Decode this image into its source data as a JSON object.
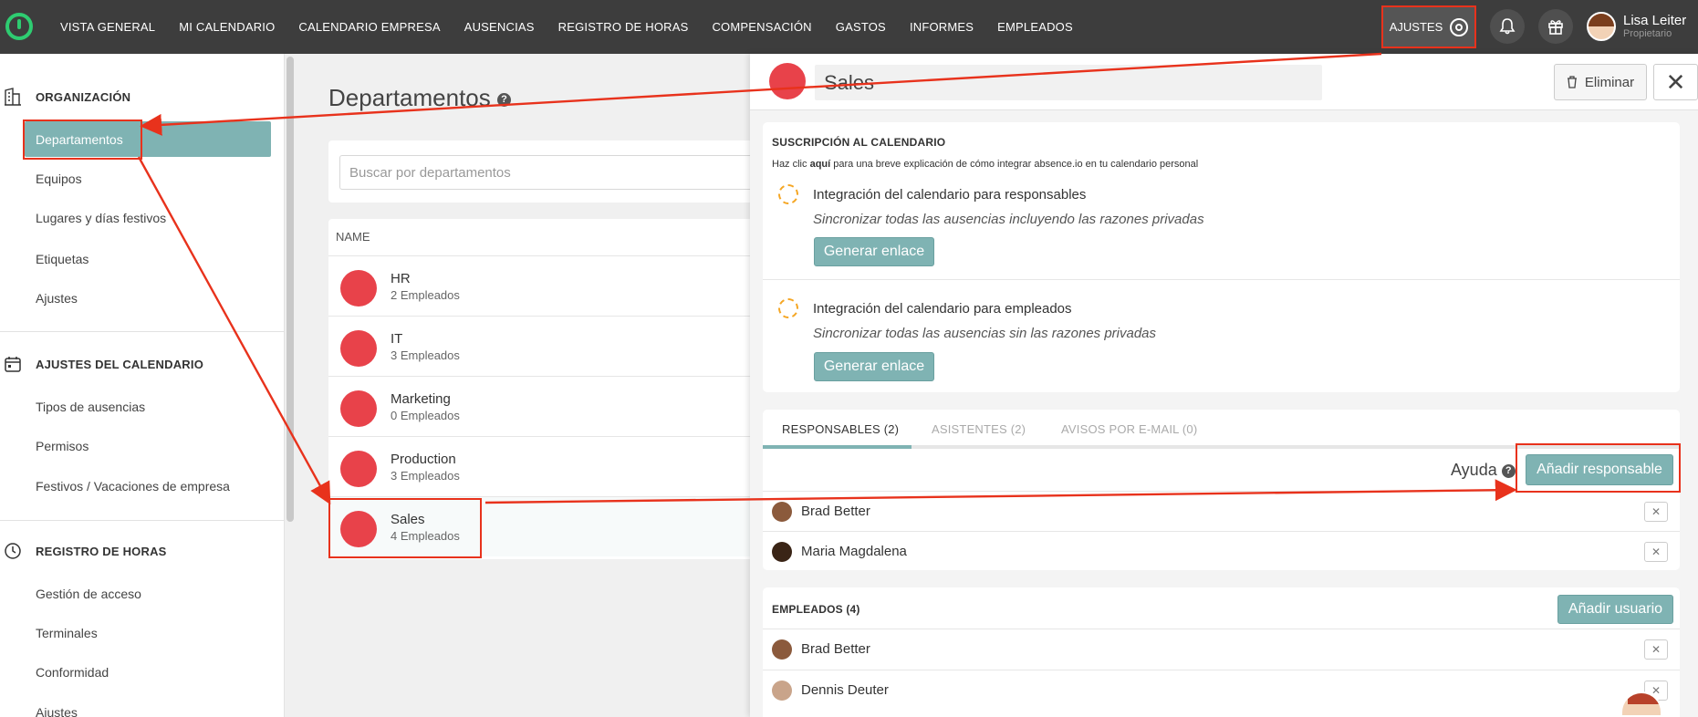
{
  "nav": {
    "items": [
      "VISTA GENERAL",
      "MI CALENDARIO",
      "CALENDARIO EMPRESA",
      "AUSENCIAS",
      "REGISTRO DE HORAS",
      "COMPENSACIÓN",
      "GASTOS",
      "INFORMES",
      "EMPLEADOS"
    ],
    "settings_label": "AJUSTES",
    "user_name": "Lisa Leiter",
    "user_role": "Propietario"
  },
  "sidebar": {
    "org_title": "ORGANIZACIÓN",
    "org_items": [
      "Departamentos",
      "Equipos",
      "Lugares y días festivos",
      "Etiquetas",
      "Ajustes"
    ],
    "cal_title": "AJUSTES DEL CALENDARIO",
    "cal_items": [
      "Tipos de ausencias",
      "Permisos",
      "Festivos / Vacaciones de empresa"
    ],
    "time_title": "REGISTRO DE HORAS",
    "time_items": [
      "Gestión de acceso",
      "Terminales",
      "Conformidad",
      "Ajustes"
    ]
  },
  "main": {
    "title": "Departamentos",
    "search_placeholder": "Buscar por departamentos",
    "column": "NAME",
    "departments": [
      {
        "name": "HR",
        "count": "2 Empleados"
      },
      {
        "name": "IT",
        "count": "3 Empleados"
      },
      {
        "name": "Marketing",
        "count": "0 Empleados"
      },
      {
        "name": "Production",
        "count": "3 Empleados"
      },
      {
        "name": "Sales",
        "count": "4 Empleados"
      }
    ]
  },
  "panel": {
    "name": "Sales",
    "delete_label": "Eliminar",
    "close_label": "✕",
    "subscription_title": "SUSCRIPCIÓN AL CALENDARIO",
    "subscription_text_prefix": "Haz clic",
    "subscription_text_link": "aquí",
    "subscription_text_suffix": "para una breve explicación de cómo integrar absence.io en tu calendario personal",
    "integrations": [
      {
        "title": "Integración del calendario para responsables",
        "desc": "Sincronizar todas las ausencias incluyendo las razones privadas",
        "button": "Generar enlace"
      },
      {
        "title": "Integración del calendario para empleados",
        "desc": "Sincronizar todas las ausencias sin las razones privadas",
        "button": "Generar enlace"
      }
    ],
    "tabs": [
      "RESPONSABLES (2)",
      "ASISTENTES (2)",
      "AVISOS POR E-MAIL (0)"
    ],
    "help_label": "Ayuda",
    "add_manager_label": "Añadir responsable",
    "managers": [
      "Brad Better",
      "Maria Magdalena"
    ],
    "employees_title": "EMPLEADOS (4)",
    "add_user_label": "Añadir usuario",
    "employees": [
      "Brad Better",
      "Dennis Deuter"
    ]
  },
  "colors": {
    "accent": "#7fb3b3",
    "highlight": "#e8321c",
    "dept_avatar": "#e8424a",
    "nav_bg": "#3d3d3d"
  }
}
